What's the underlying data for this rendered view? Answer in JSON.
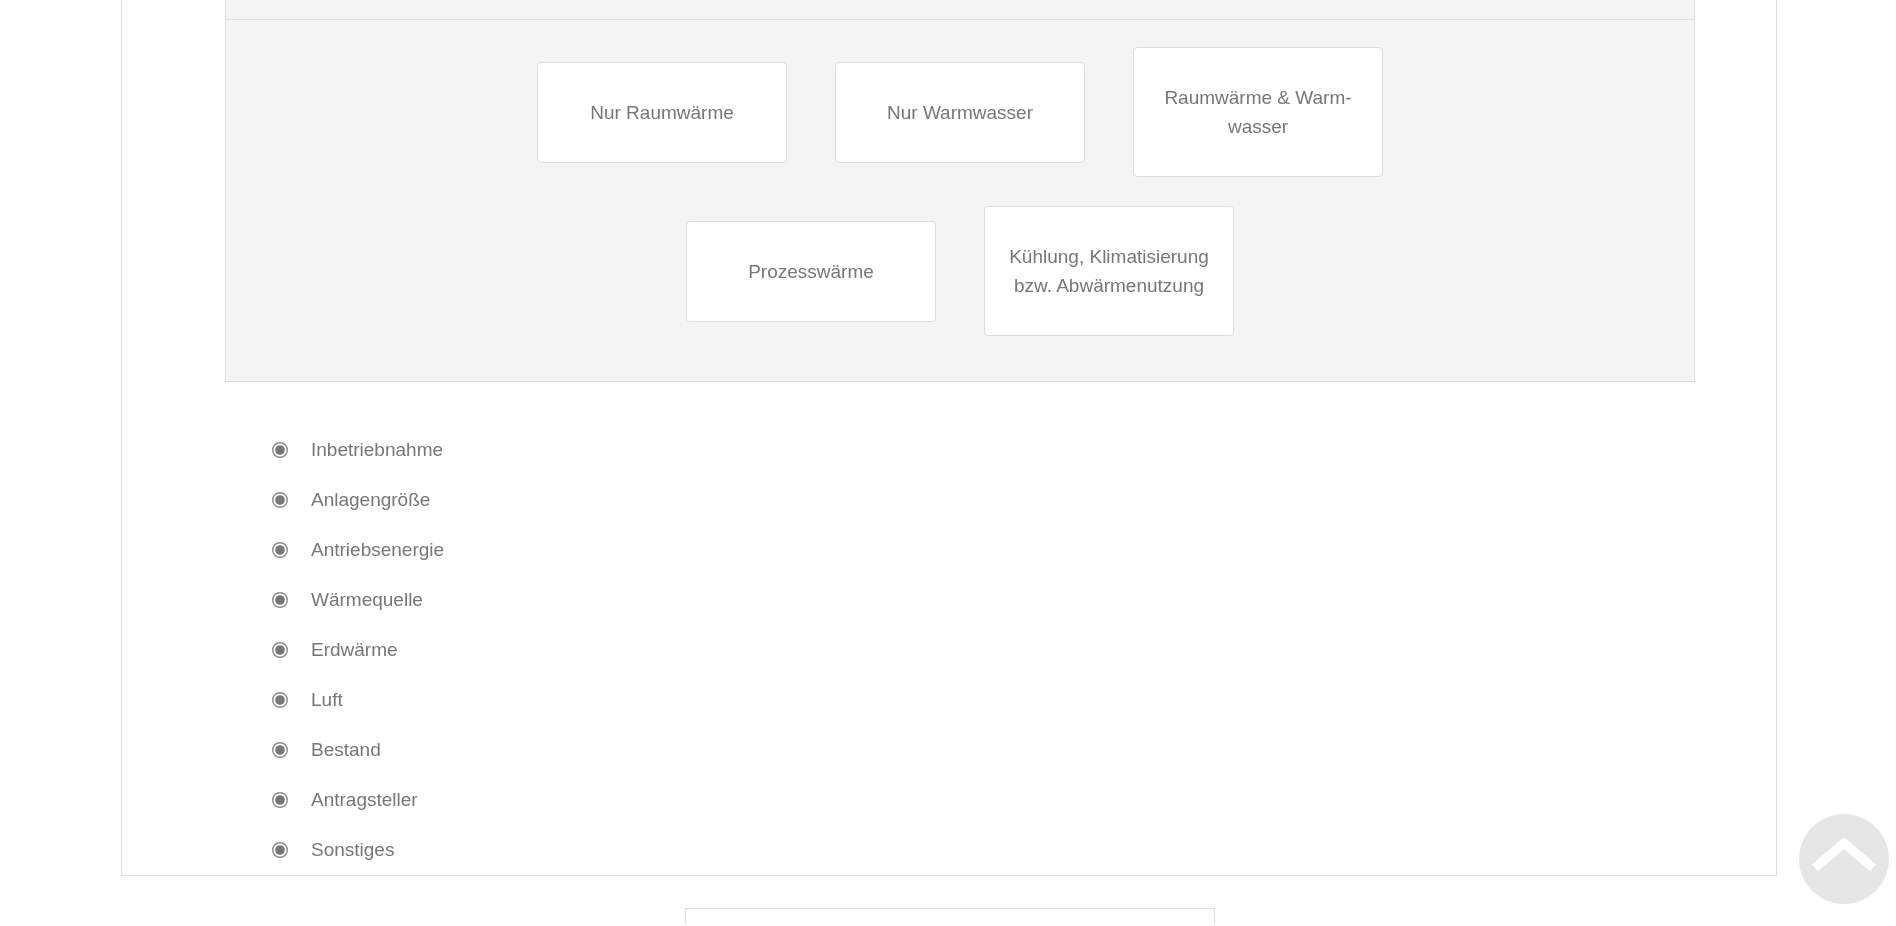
{
  "options_panel": {
    "options": [
      {
        "label": "Nur Raumwärme"
      },
      {
        "label": "Nur Warmwasser"
      },
      {
        "label": "Raumwärme & Warm-wasser"
      },
      {
        "label": "Prozesswärme"
      },
      {
        "label": "Kühlung, Klimatisierung bzw. Abwärmenutzung"
      }
    ]
  },
  "sections": [
    {
      "label": "Inbetriebnahme"
    },
    {
      "label": "Anlagengröße"
    },
    {
      "label": "Antriebsenergie"
    },
    {
      "label": "Wärmequelle"
    },
    {
      "label": "Erdwärme"
    },
    {
      "label": "Luft"
    },
    {
      "label": "Bestand"
    },
    {
      "label": "Antragsteller"
    },
    {
      "label": "Sonstiges"
    }
  ]
}
